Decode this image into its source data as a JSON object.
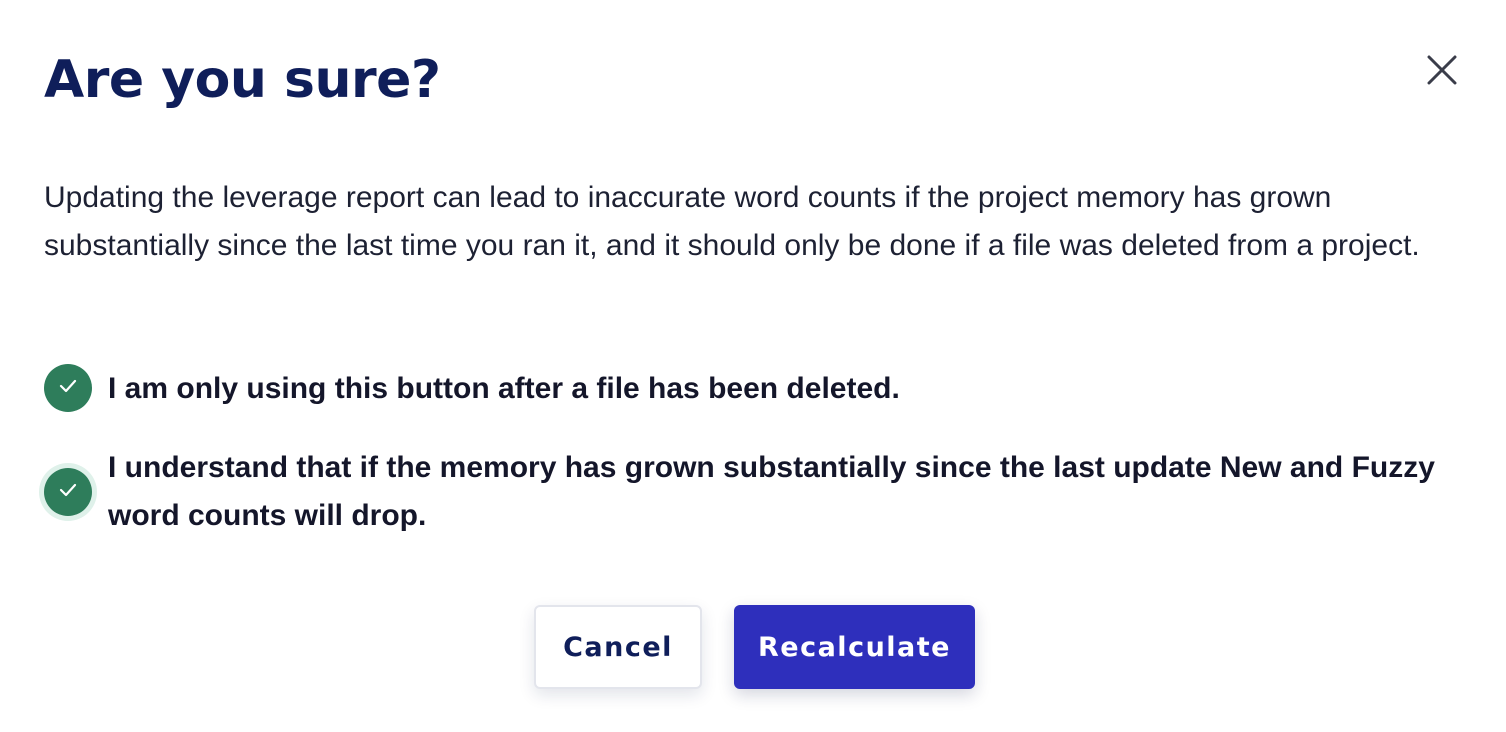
{
  "dialog": {
    "title": "Are you sure?",
    "close_icon": "close-icon",
    "message": "Updating the leverage report can lead to inaccurate word counts if the project memory has grown substantially since the last time you ran it, and it should only be done if a file was deleted from a project.",
    "confirmations": [
      {
        "label": "I am only using this button after a file has been deleted.",
        "checked": true,
        "icon": "check-icon"
      },
      {
        "label": "I understand that if the memory has grown substantially since the last update New and Fuzzy word counts will drop.",
        "checked": true,
        "icon": "check-icon"
      }
    ],
    "buttons": {
      "cancel_label": "Cancel",
      "primary_label": "Recalculate"
    }
  },
  "colors": {
    "title": "#0f1e5a",
    "check_fill": "#2e7d5b",
    "primary_button": "#2e2fbc",
    "cancel_text": "#0f1e5a"
  }
}
